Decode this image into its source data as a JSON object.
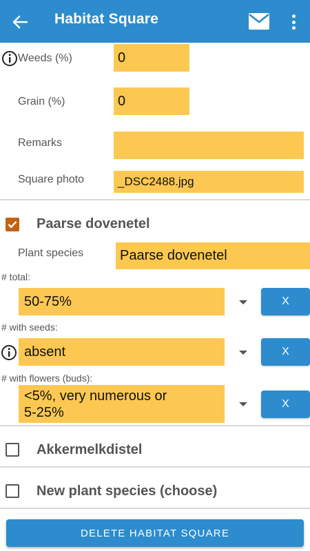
{
  "appbar": {
    "title": "Habitat Square",
    "back_icon": "arrow-left-icon",
    "mail_icon": "mail-icon",
    "more_icon": "more-vertical-icon",
    "color": "#2c8ccd"
  },
  "form": {
    "weeds": {
      "label": "Weeds (%)",
      "value": "0"
    },
    "grain": {
      "label": "Grain (%)",
      "value": "0"
    },
    "remarks": {
      "label": "Remarks",
      "value": ""
    },
    "square_photo": {
      "label": "Square photo",
      "value": "_DSC2488.jpg"
    }
  },
  "species_section": {
    "checked": true,
    "title": "Paarse dovenetel",
    "plant_species_label": "Plant species",
    "plant_species_value": "Paarse dovenetel",
    "total": {
      "label": "# total:",
      "value": "50-75%",
      "clear_label": "X"
    },
    "with_seeds": {
      "label": "# with seeds:",
      "value": "absent",
      "clear_label": "X"
    },
    "with_flowers": {
      "label": "# with flowers (buds):",
      "value_line1": "<5%, very numerous or",
      "value_line2": "5-25%",
      "clear_label": "X"
    }
  },
  "other_species": [
    {
      "checked": false,
      "title": "Akkermelkdistel"
    },
    {
      "checked": false,
      "title": "New plant species (choose)"
    }
  ],
  "delete_button_label": "DELETE HABITAT SQUARE",
  "colors": {
    "field": "#fdc851",
    "accent": "#2c8ccd",
    "checkbox": "#c06414"
  }
}
